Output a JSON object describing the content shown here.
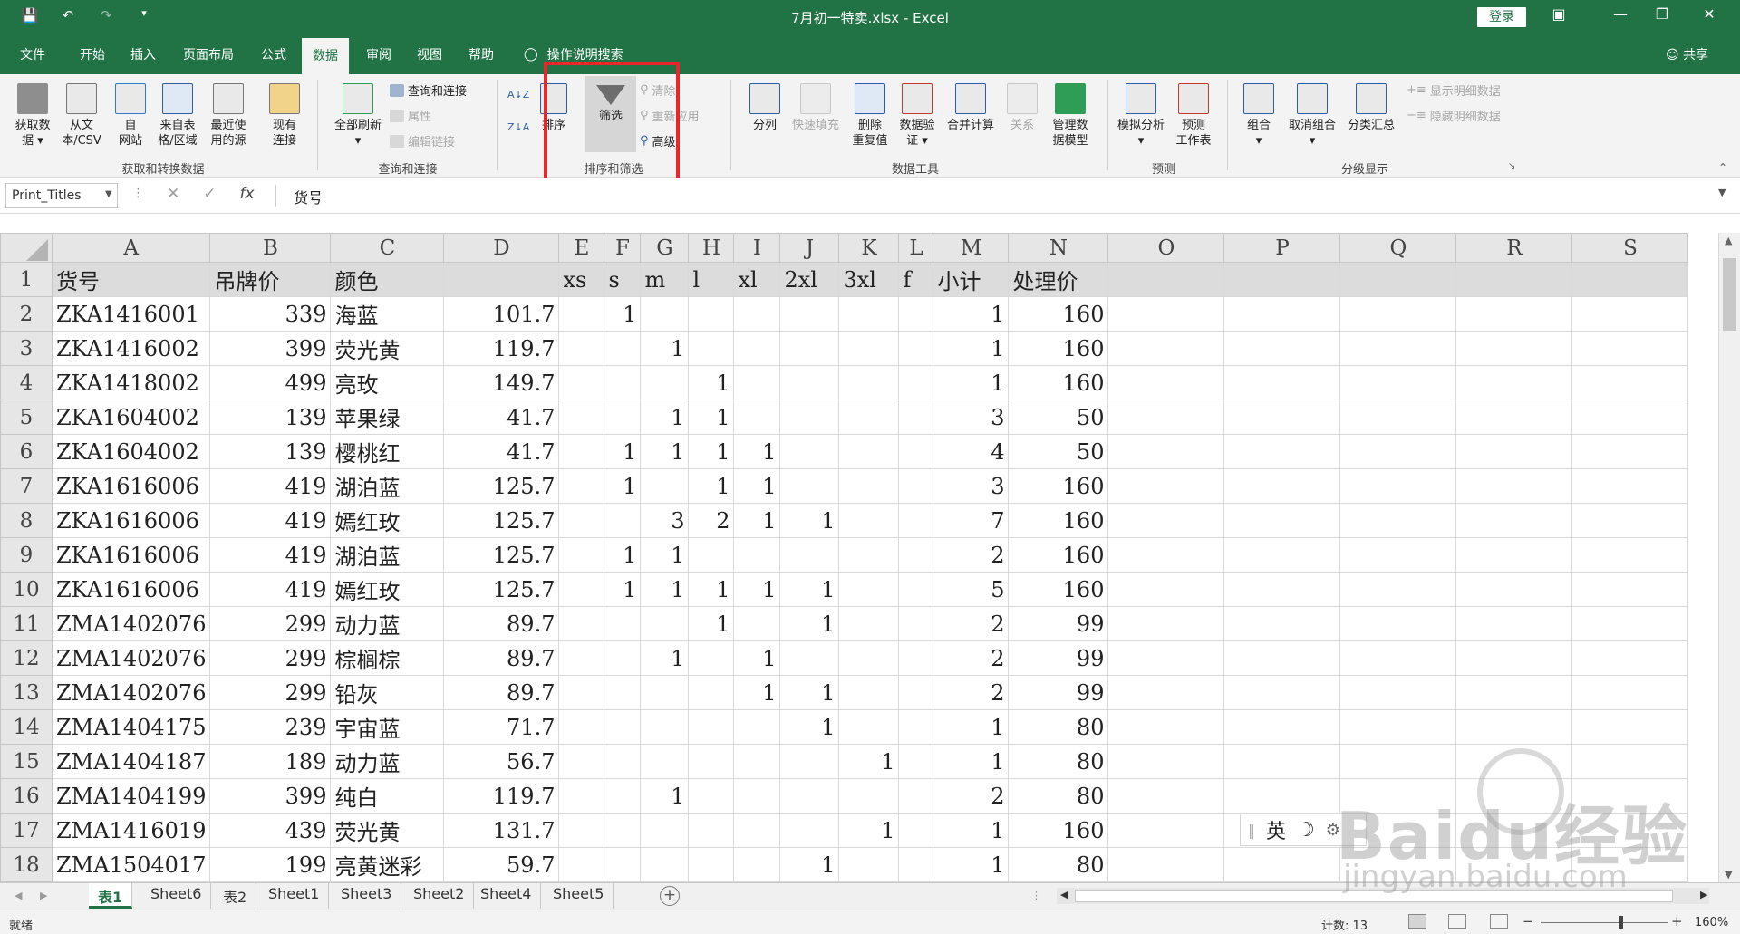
{
  "titlebar": {
    "title": "7月初一特卖.xlsx  -  Excel",
    "login_label": "登录",
    "qat": [
      "save-icon",
      "undo-icon",
      "redo-icon",
      "customize-icon"
    ]
  },
  "tabs": [
    "文件",
    "开始",
    "插入",
    "页面布局",
    "公式",
    "数据",
    "审阅",
    "视图",
    "帮助"
  ],
  "active_tab": "数据",
  "search_label": "操作说明搜索",
  "share_label": "共享",
  "ribbon": {
    "get_data": [
      "获取数\n据 ▾",
      "从文\n本/CSV",
      "自\n网站",
      "来自表\n格/区域",
      "最近使\n用的源",
      "现有\n连接"
    ],
    "group_get": "获取和转换数据",
    "refresh_all": "全部刷新\n▾",
    "queries": [
      "查询和连接",
      "属性",
      "编辑链接"
    ],
    "group_queries": "查询和连接",
    "sort": "排序",
    "filter": "筛选",
    "filter_small": [
      "清除",
      "重新应用",
      "高级"
    ],
    "group_sort": "排序和筛选",
    "tools": [
      "分列",
      "快速填充",
      "删除\n重复值",
      "数据验\n证 ▾",
      "合并计算",
      "关系",
      "管理数\n据模型"
    ],
    "group_tools": "数据工具",
    "forecast": [
      "模拟分析\n▾",
      "预测\n工作表"
    ],
    "group_forecast": "预测",
    "outline": [
      "组合\n▾",
      "取消组合\n▾",
      "分类汇总"
    ],
    "outline_small": [
      "显示明细数据",
      "隐藏明细数据"
    ],
    "group_outline": "分级显示"
  },
  "formula_bar": {
    "name_box": "Print_Titles",
    "fx": "fx",
    "content": "货号"
  },
  "columns": [
    "A",
    "B",
    "C",
    "D",
    "E",
    "F",
    "G",
    "H",
    "I",
    "J",
    "K",
    "L",
    "M",
    "N",
    "O",
    "P",
    "Q",
    "R",
    "S"
  ],
  "header_row": [
    "货号",
    "吊牌价",
    "颜色",
    "",
    "xs",
    "s",
    "m",
    "l",
    "xl",
    "2xl",
    "3xl",
    "f",
    "小计",
    "处理价"
  ],
  "rows": [
    [
      "ZKA1416001",
      "339",
      "海蓝",
      "101.7",
      "",
      "1",
      "",
      "",
      "",
      "",
      "",
      "",
      "1",
      "160"
    ],
    [
      "ZKA1416002",
      "399",
      "荧光黄",
      "119.7",
      "",
      "",
      "1",
      "",
      "",
      "",
      "",
      "",
      "1",
      "160"
    ],
    [
      "ZKA1418002",
      "499",
      "亮玫",
      "149.7",
      "",
      "",
      "",
      "1",
      "",
      "",
      "",
      "",
      "1",
      "160"
    ],
    [
      "ZKA1604002",
      "139",
      "苹果绿",
      "41.7",
      "",
      "",
      "1",
      "1",
      "",
      "",
      "",
      "",
      "3",
      "50"
    ],
    [
      "ZKA1604002",
      "139",
      "樱桃红",
      "41.7",
      "",
      "1",
      "1",
      "1",
      "1",
      "",
      "",
      "",
      "4",
      "50"
    ],
    [
      "ZKA1616006",
      "419",
      "湖泊蓝",
      "125.7",
      "",
      "1",
      "",
      "1",
      "1",
      "",
      "",
      "",
      "3",
      "160"
    ],
    [
      "ZKA1616006",
      "419",
      "嫣红玫",
      "125.7",
      "",
      "",
      "3",
      "2",
      "1",
      "1",
      "",
      "",
      "7",
      "160"
    ],
    [
      "ZKA1616006",
      "419",
      "湖泊蓝",
      "125.7",
      "",
      "1",
      "1",
      "",
      "",
      "",
      "",
      "",
      "2",
      "160"
    ],
    [
      "ZKA1616006",
      "419",
      "嫣红玫",
      "125.7",
      "",
      "1",
      "1",
      "1",
      "1",
      "1",
      "",
      "",
      "5",
      "160"
    ],
    [
      "ZMA1402076",
      "299",
      "动力蓝",
      "89.7",
      "",
      "",
      "",
      "1",
      "",
      "1",
      "",
      "",
      "2",
      "99"
    ],
    [
      "ZMA1402076",
      "299",
      "棕榈棕",
      "89.7",
      "",
      "",
      "1",
      "",
      "1",
      "",
      "",
      "",
      "2",
      "99"
    ],
    [
      "ZMA1402076",
      "299",
      "铅灰",
      "89.7",
      "",
      "",
      "",
      "",
      "1",
      "1",
      "",
      "",
      "2",
      "99"
    ],
    [
      "ZMA1404175",
      "239",
      "宇宙蓝",
      "71.7",
      "",
      "",
      "",
      "",
      "",
      "1",
      "",
      "",
      "1",
      "80"
    ],
    [
      "ZMA1404187",
      "189",
      "动力蓝",
      "56.7",
      "",
      "",
      "",
      "",
      "",
      "",
      "1",
      "",
      "1",
      "80"
    ],
    [
      "ZMA1404199",
      "399",
      "纯白",
      "119.7",
      "",
      "",
      "1",
      "",
      "",
      "",
      "",
      "",
      "2",
      "80"
    ],
    [
      "ZMA1416019",
      "439",
      "荧光黄",
      "131.7",
      "",
      "",
      "",
      "",
      "",
      "",
      "1",
      "",
      "1",
      "160"
    ],
    [
      "ZMA1504017",
      "199",
      "亮黄迷彩",
      "59.7",
      "",
      "",
      "",
      "",
      "",
      "1",
      "",
      "",
      "1",
      "80"
    ]
  ],
  "sheet_tabs": [
    "表1",
    "Sheet6",
    "表2",
    "Sheet1",
    "Sheet3",
    "Sheet2",
    "Sheet4",
    "Sheet5"
  ],
  "active_sheet": "表1",
  "status": {
    "ready": "就绪",
    "count": "计数: 13",
    "zoom": "160%"
  },
  "ime": {
    "lang": "英",
    "moon": "☽",
    "gear": "⚙"
  },
  "watermark": {
    "brand": "Baidu经验",
    "url": "jingyan.baidu.com"
  },
  "colors": {
    "excel_green": "#217346",
    "highlight_red": "#e8262c"
  }
}
